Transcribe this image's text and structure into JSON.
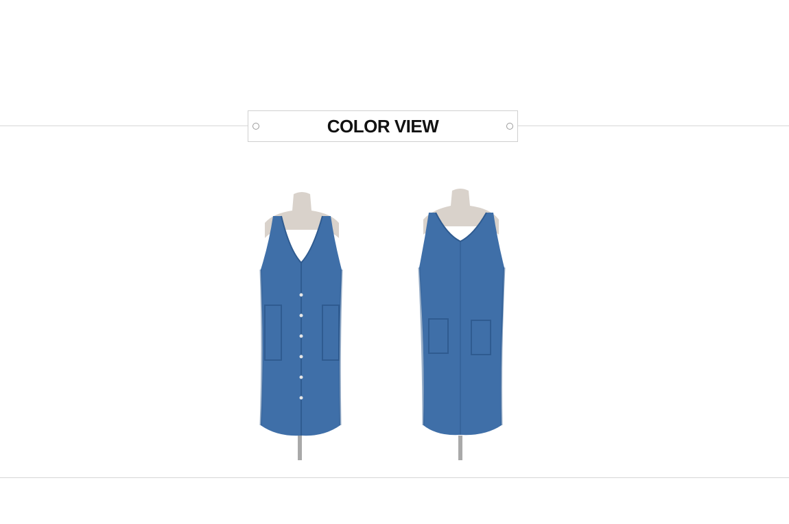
{
  "section": {
    "title": "COLOR VIEW"
  },
  "photos": [
    {
      "name": "front-view",
      "description_color": "#3f6fa8"
    },
    {
      "name": "back-view",
      "description_color": "#3f6fa8"
    }
  ],
  "colors": {
    "denim": "#3f6fa8",
    "denim_dark": "#2f5b90",
    "mannequin": "#d9d2cb",
    "stand": "#a9a9a9",
    "rule": "#d6d6d6"
  }
}
